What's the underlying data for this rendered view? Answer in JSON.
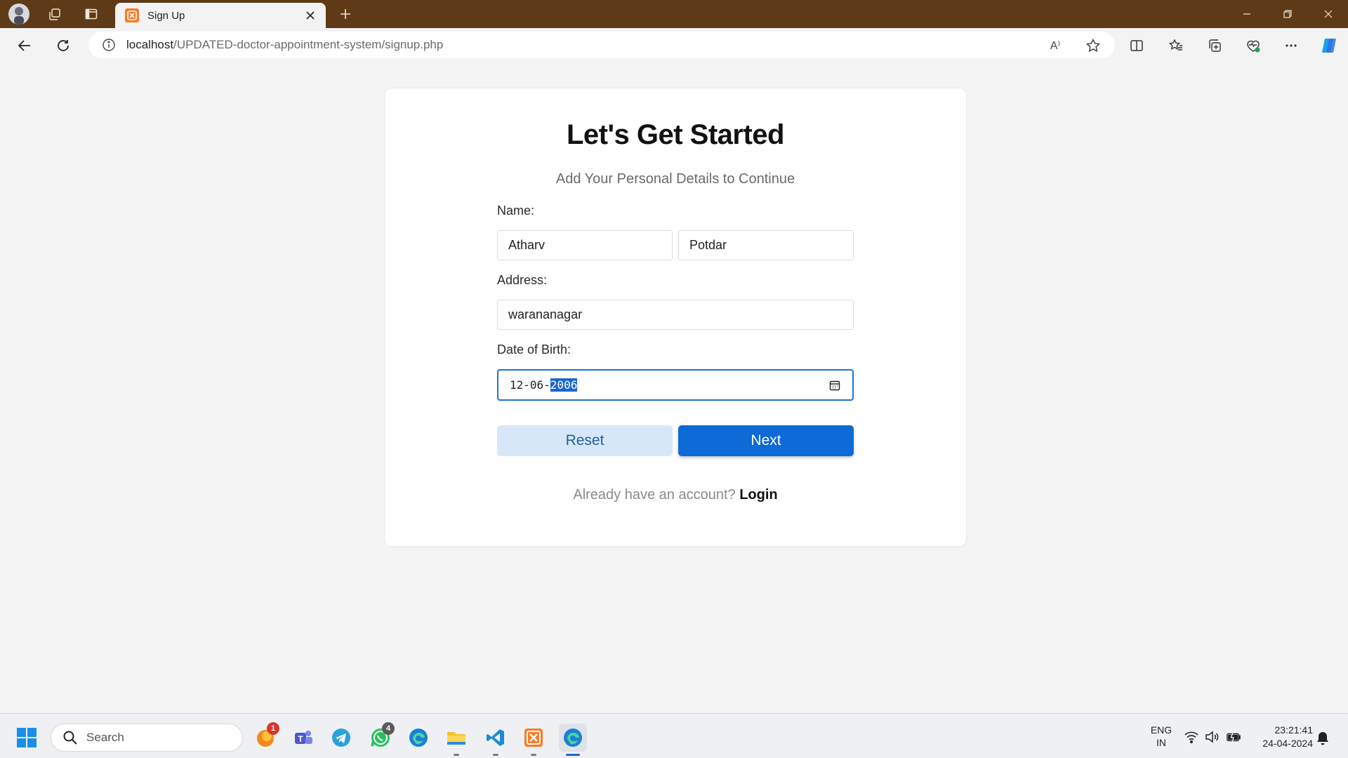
{
  "browser": {
    "tab_title": "Sign Up",
    "tab_favicon_text": "⊠",
    "url_host": "localhost",
    "url_path": "/UPDATED-doctor-appointment-system/signup.php",
    "read_aloud_glyph": "A⁾"
  },
  "page": {
    "heading": "Let's Get Started",
    "subheading": "Add Your Personal Details to Continue",
    "name_label": "Name:",
    "first_name": "Atharv",
    "last_name": "Potdar",
    "address_label": "Address:",
    "address": "warananagar",
    "dob_label": "Date of Birth:",
    "dob_day_month": "12-06-",
    "dob_year": "2006",
    "reset_label": "Reset",
    "next_label": "Next",
    "login_prompt": "Already have an account? ",
    "login_link": "Login"
  },
  "taskbar": {
    "search_placeholder": "Search",
    "badge_firefox": "1",
    "badge_whatsapp": "4",
    "lang_line1": "ENG",
    "lang_line2": "IN",
    "time": "23:21:41",
    "date": "24-04-2024"
  },
  "colors": {
    "titlebar": "#5e3a16",
    "accent": "#0d6ad6",
    "reset_bg": "#d6e8f8"
  }
}
